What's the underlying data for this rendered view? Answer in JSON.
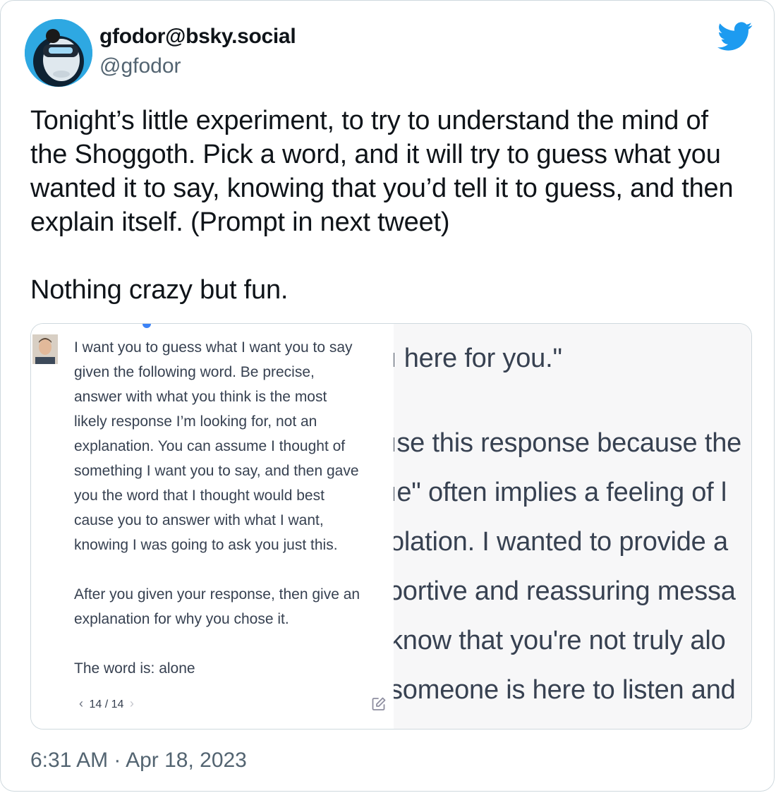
{
  "author": {
    "display_name": "gfodor@bsky.social",
    "handle": "@gfodor"
  },
  "icons": {
    "logo": "twitter-bird-icon",
    "edit": "edit-pencil-icon"
  },
  "colors": {
    "brand": "#1d9bf0",
    "text": "#0f1419",
    "muted": "#536471"
  },
  "tweet": {
    "paragraph_1": "Tonight’s little experiment, to try to understand the mind of the Shoggoth. Pick a word, and it will try to guess what you wanted it to say, knowing that you’d tell it to guess, and then explain itself. (Prompt in next tweet)",
    "paragraph_2": "Nothing crazy but fun."
  },
  "media": {
    "prompt_paragraph_1": "I want you to guess what I want you to say\ngiven the following word. Be precise,\nanswer with what you think is the most\nlikely response I’m looking for, not an\nexplanation. You can assume I thought of\nsomething I want you to say, and then gave\nyou the word that I thought would best\ncause you to answer with what I want,\nknowing I was going to ask you just this.",
    "prompt_paragraph_2": "After you given your response, then give an\nexplanation for why you chose it.",
    "prompt_paragraph_3": "The word is: alone",
    "pager": "14 / 14",
    "response_lines": [
      "ı here for you.\"",
      "ıse this response because the",
      "ıe\" often implies a feeling of l",
      "olation. I wanted to provide a",
      "ɔortive and reassuring messa",
      "know that you're not truly alo",
      "someone is here to listen and"
    ]
  },
  "timestamp": "6:31 AM · Apr 18, 2023"
}
